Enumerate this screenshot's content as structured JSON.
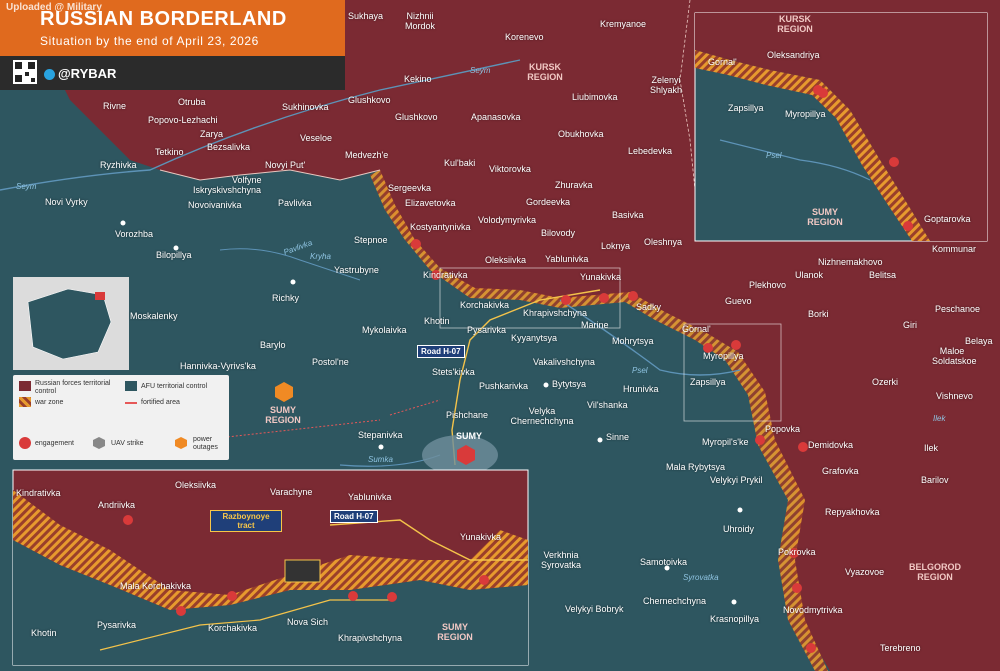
{
  "header": {
    "watermark": "Uploaded @ Military",
    "title": "RUSSIAN BORDERLAND",
    "subtitle": "Situation by the end of April 23, 2026",
    "handle": "@RYBAR"
  },
  "colors": {
    "russian_control": "#7b2a33",
    "afu_control": "#2e5660",
    "war_zone": "#e79a2e",
    "engagement": "#d93a3a",
    "accent": "#e06a1e"
  },
  "legend": {
    "russian_forces": "Russian forces territorial control",
    "afu_control": "AFU territorial control",
    "war_zone": "war zone",
    "fortified": "fortified area",
    "engagement": "engagement",
    "uav_strike": "UAV strike",
    "power_outages": "power outages"
  },
  "regions": {
    "kursk_main": "KURSK REGION",
    "sumy_main": "SUMY REGION",
    "belgorod": "BELGOROD REGION",
    "kursk_inset": "KURSK REGION",
    "sumy_inset_ne": "SUMY REGION",
    "sumy_inset_bottom": "SUMY REGION"
  },
  "rivers": {
    "seym_top": "Seym",
    "seym_left": "Seym",
    "pavlivka": "Pavlivka",
    "kryha": "Kryha",
    "psel": "Psel",
    "psel_inset": "Psel",
    "sumka": "Sumka",
    "ilek": "Ilek",
    "syrovatka": "Syrovatka"
  },
  "roads": {
    "h07_main": "Road H-07",
    "h07_inset": "Road H-07",
    "tract": "Razboynoye tract"
  },
  "places": {
    "sukhaya": "Sukhaya",
    "nizhnii_mordok": "Nizhnii Mordok",
    "korenevo": "Korenevo",
    "kremyanoe": "Kremyanoe",
    "kekino": "Kekino",
    "lubimovka": "Liubimovka",
    "zeleni_shlyakh": "Zelenyi Shlyakh",
    "otruba": "Otruba",
    "rivne": "Rivne",
    "sukhinovka": "Sukhinovka",
    "glushkovo": "Glushkovo",
    "popovo": "Popovo-Lezhachi",
    "zarya": "Zarya",
    "glushkovo2": "Glushkovo",
    "apanasovka": "Apanasovka",
    "obukhovka": "Obukhovka",
    "tetkino": "Tetkino",
    "bezsalivka": "Bezsalivka",
    "veseloe": "Veseloe",
    "medvezhe": "Medvezh'e",
    "lebedevka": "Lebedevka",
    "ryzhivka": "Ryzhivka",
    "volfyne": "Volfyne",
    "novyi_put": "Novyi Put'",
    "kulbaki": "Kul'baki",
    "viktorovka": "Viktorovka",
    "iskryskivshchyna": "Iskryskivshchyna",
    "sergeevka": "Sergeevka",
    "zhuravka": "Zhuravka",
    "novi_vyrky": "Novi Vyrky",
    "novoivanivka": "Novoivanivka",
    "pavlivka": "Pavlivka",
    "elizavetovka": "Elizavetovka",
    "gordeevka": "Gordeevka",
    "volodymyrivka": "Volodymyrivka",
    "basivka": "Basivka",
    "vorozhba": "Vorozhba",
    "kostyantynivka": "Kostyantynivka",
    "bilovody": "Bilovody",
    "stepnoe": "Stepnoe",
    "loknya": "Loknya",
    "oleshnya": "Oleshnya",
    "bilopillya": "Bilopillya",
    "oleksiivka": "Oleksiivka",
    "yablunivka": "Yablunivka",
    "kindrativka": "Kindrativka",
    "yunakivka": "Yunakivka",
    "yastrubyne": "Yastrubyne",
    "richky": "Richky",
    "korchakivka": "Korchakivka",
    "sadky": "Sadky",
    "moskalenky": "Moskalenky",
    "khrapivshchyna": "Khrapivshchyna",
    "khotin": "Khotin",
    "mykolaivka": "Mykolaivka",
    "pysarivka": "Pysarivka",
    "marine": "Marine",
    "kyyanytsya": "Kyyanytsya",
    "mohrytsya": "Mohrytsya",
    "barylo": "Barylo",
    "postolne": "Postol'ne",
    "vakalivshchyna": "Vakalivshchyna",
    "hannivka": "Hannivka-Vyrivs'ka",
    "stetskivka": "Stets'kivka",
    "pushkarivka": "Pushkarivka",
    "bytytsya": "Bytytsya",
    "hrunivka": "Hrunivka",
    "pishchane": "Pishchane",
    "velyka_chernechchyna": "Velyka Chernechchyna",
    "vilshanka": "Vil'shanka",
    "stepanivka": "Stepanivka",
    "sumy": "SUMY",
    "sinne": "Sinne",
    "nizhnemakhovo": "Nizhnemakhovo",
    "kommunar": "Kommunar",
    "ulanok": "Ulanok",
    "plekhovo": "Plekhovo",
    "belitsa": "Belitsa",
    "peschanoe": "Peschanoe",
    "guevo": "Guevo",
    "borki": "Borki",
    "giri": "Giri",
    "belaya": "Belaya",
    "gornal": "Gornal'",
    "myropillya": "Myropillya",
    "zapsillya": "Zapsillya",
    "maloe_soldatskoe": "Maloe Soldatskoe",
    "ozerki": "Ozerki",
    "vishnevo": "Vishnevo",
    "popovka": "Popovka",
    "demidovka": "Demidovka",
    "myropilske": "Myropil's'ke",
    "ilek_town": "Ilek",
    "mala_rybytsya": "Mala Rybytsya",
    "grafovka": "Grafovka",
    "velykyi_prykil": "Velykyi Prykil",
    "barilov": "Barilov",
    "repyakhovka": "Repyakhovka",
    "uhroidy": "Uhroidy",
    "verkhnia_syrovatka": "Verkhnia Syrovatka",
    "samotoivka": "Samotoivka",
    "pokrovka": "Pokrovka",
    "vyazovoe": "Vyazovoe",
    "chernechchyna": "Chernechchyna",
    "velykyi_bobryk": "Velykyi Bobryk",
    "krasnopillya": "Krasnopillya",
    "novodmytrivka": "Novodmytrivka",
    "terebreno": "Terebreno"
  },
  "inset_ne": {
    "gornal": "Gornal'",
    "oleksandriya": "Oleksandriya",
    "zapsillya": "Zapsillya",
    "myropillya": "Myropillya",
    "goptarovka": "Goptarovka"
  },
  "inset_bottom": {
    "kindrativka": "Kindrativka",
    "andriivka": "Andriivka",
    "oleksiivka": "Oleksiivka",
    "varachyne": "Varachyne",
    "yablunivka": "Yablunivka",
    "yunakivka": "Yunakivka",
    "mala_korchakivka": "Mala Korchakivka",
    "pysarivka": "Pysarivka",
    "korchakivka": "Korchakivka",
    "nova_sich": "Nova Sich",
    "khrapivshchyna": "Khrapivshchyna",
    "khotin": "Khotin"
  }
}
